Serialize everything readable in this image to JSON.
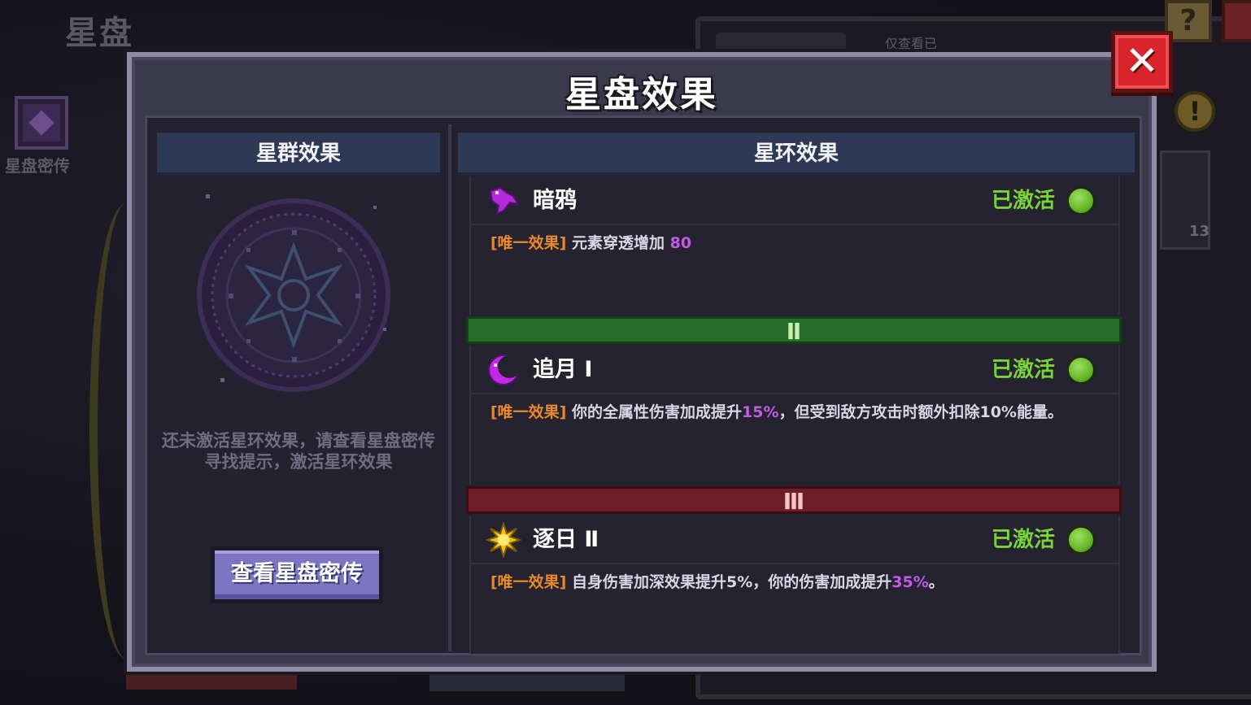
{
  "background": {
    "title": "星盘",
    "book_label": "星盘密传",
    "filter_text": "仅查看已",
    "help_glyph": "?",
    "warn_glyph": "!",
    "card_count": "13"
  },
  "modal": {
    "title": "星盘效果",
    "close_glyph": "✕",
    "left": {
      "header": "星群效果",
      "hint": "还未激活星环效果，请查看星盘密传寻找提示，激活星环效果",
      "button": "查看星盘密传"
    },
    "right": {
      "header": "星环效果",
      "effects": [
        {
          "name": "暗鸦",
          "icon": "raven-icon",
          "status": "已激活",
          "tag": "[唯一效果]",
          "desc_pre": " 元素穿透增加 ",
          "desc_hl": "80",
          "desc_post": ""
        },
        {
          "name": "追月 Ⅰ",
          "icon": "moon-icon",
          "status": "已激活",
          "tag": "[唯一效果]",
          "desc_pre": " 你的全属性伤害加成提升",
          "desc_hl": "15%",
          "desc_post": "，但受到敌方攻击时额外扣除10%能量。"
        },
        {
          "name": "逐日 Ⅱ",
          "icon": "sun-icon",
          "status": "已激活",
          "tag": "[唯一效果]",
          "desc_pre": " 自身伤害加深效果提升5%，你的伤害加成提升",
          "desc_hl": "35%",
          "desc_post": "。"
        }
      ],
      "tiers": [
        "Ⅱ",
        "Ⅲ"
      ]
    }
  },
  "colors": {
    "active_green": "#78d33b",
    "tag_orange": "#e8892a",
    "highlight_purple": "#c35ae8",
    "tier2_green": "#276e2a",
    "tier3_red": "#6e1c26",
    "close_red": "#d8242a",
    "button_purple": "#7d74c2"
  }
}
